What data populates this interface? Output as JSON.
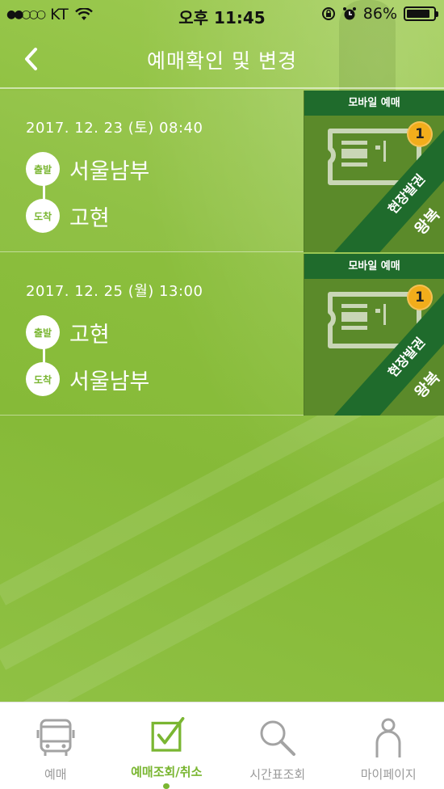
{
  "status_bar": {
    "carrier": "KT",
    "time": "오후 11:45",
    "battery": "86%",
    "battery_level": 0.86
  },
  "header": {
    "title": "예매확인 및 변경"
  },
  "tickets": [
    {
      "date": "2017. 12. 23 (토) 08:40",
      "departure_label": "출발",
      "departure": "서울남부",
      "arrival_label": "도착",
      "arrival": "고현",
      "mobile_label": "모바일 예매",
      "count": "1",
      "issue_label": "현장발권",
      "trip_type": "왕복"
    },
    {
      "date": "2017. 12. 25 (월) 13:00",
      "departure_label": "출발",
      "departure": "고현",
      "arrival_label": "도착",
      "arrival": "서울남부",
      "mobile_label": "모바일 예매",
      "count": "1",
      "issue_label": "현장발권",
      "trip_type": "왕복"
    }
  ],
  "tabs": [
    {
      "label": "예매",
      "icon": "bus-icon"
    },
    {
      "label": "예매조회/취소",
      "icon": "checkbox-icon",
      "active": true
    },
    {
      "label": "시간표조회",
      "icon": "search-icon"
    },
    {
      "label": "마이페이지",
      "icon": "user-icon"
    }
  ],
  "colors": {
    "accent": "#7ab632",
    "dark_green": "#1f6b2c",
    "badge": "#f2ad1b"
  }
}
